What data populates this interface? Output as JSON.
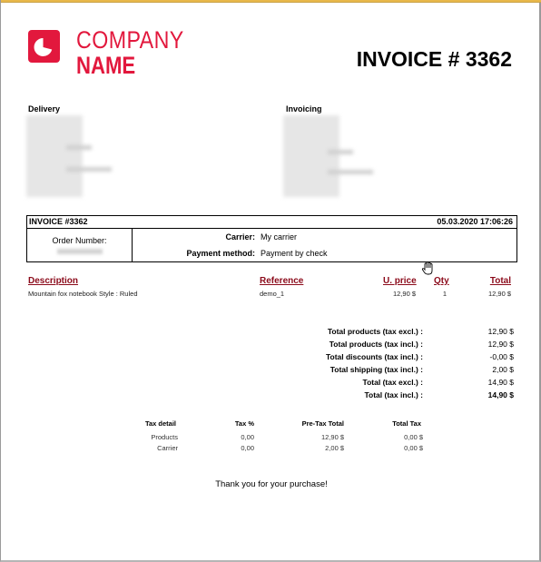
{
  "company": {
    "line1": "COMPANY",
    "line2": "NAME",
    "brand_color": "#e2183d",
    "logo_icon": "pie-chart-icon"
  },
  "invoice_title": "INVOICE # 3362",
  "addresses": {
    "delivery_label": "Delivery",
    "invoicing_label": "Invoicing"
  },
  "info": {
    "header_left": "INVOICE #3362",
    "header_right": "05.03.2020 17:06:26",
    "order_number_label": "Order Number:",
    "carrier_label": "Carrier:",
    "carrier_value": "My carrier",
    "payment_label": "Payment method:",
    "payment_value": "Payment by check"
  },
  "products": {
    "header_color": "#8b0a1a",
    "columns": [
      "Description",
      "Reference",
      "U. price",
      "Qty",
      "Total"
    ],
    "rows": [
      {
        "description": "Mountain fox notebook Style : Ruled",
        "reference": "demo_1",
        "unit_price": "12,90 $",
        "qty": "1",
        "total": "12,90 $"
      }
    ]
  },
  "totals": [
    {
      "label": "Total products (tax excl.) :",
      "value": "12,90 $"
    },
    {
      "label": "Total products (tax incl.) :",
      "value": "12,90 $"
    },
    {
      "label": "Total discounts (tax incl.) :",
      "value": "-0,00 $"
    },
    {
      "label": "Total shipping (tax incl.) :",
      "value": "2,00 $"
    },
    {
      "label": "Total (tax excl.) :",
      "value": "14,90 $"
    },
    {
      "label": "Total (tax incl.) :",
      "value": "14,90 $"
    }
  ],
  "tax": {
    "columns": [
      "Tax detail",
      "Tax %",
      "Pre-Tax Total",
      "Total Tax"
    ],
    "rows": [
      {
        "detail": "Products",
        "rate": "0,00",
        "pretax": "12,90 $",
        "tax": "0,00 $"
      },
      {
        "detail": "Carrier",
        "rate": "0,00",
        "pretax": "2,00 $",
        "tax": "0,00 $"
      }
    ]
  },
  "footer": {
    "thanks": "Thank you for your purchase!"
  }
}
